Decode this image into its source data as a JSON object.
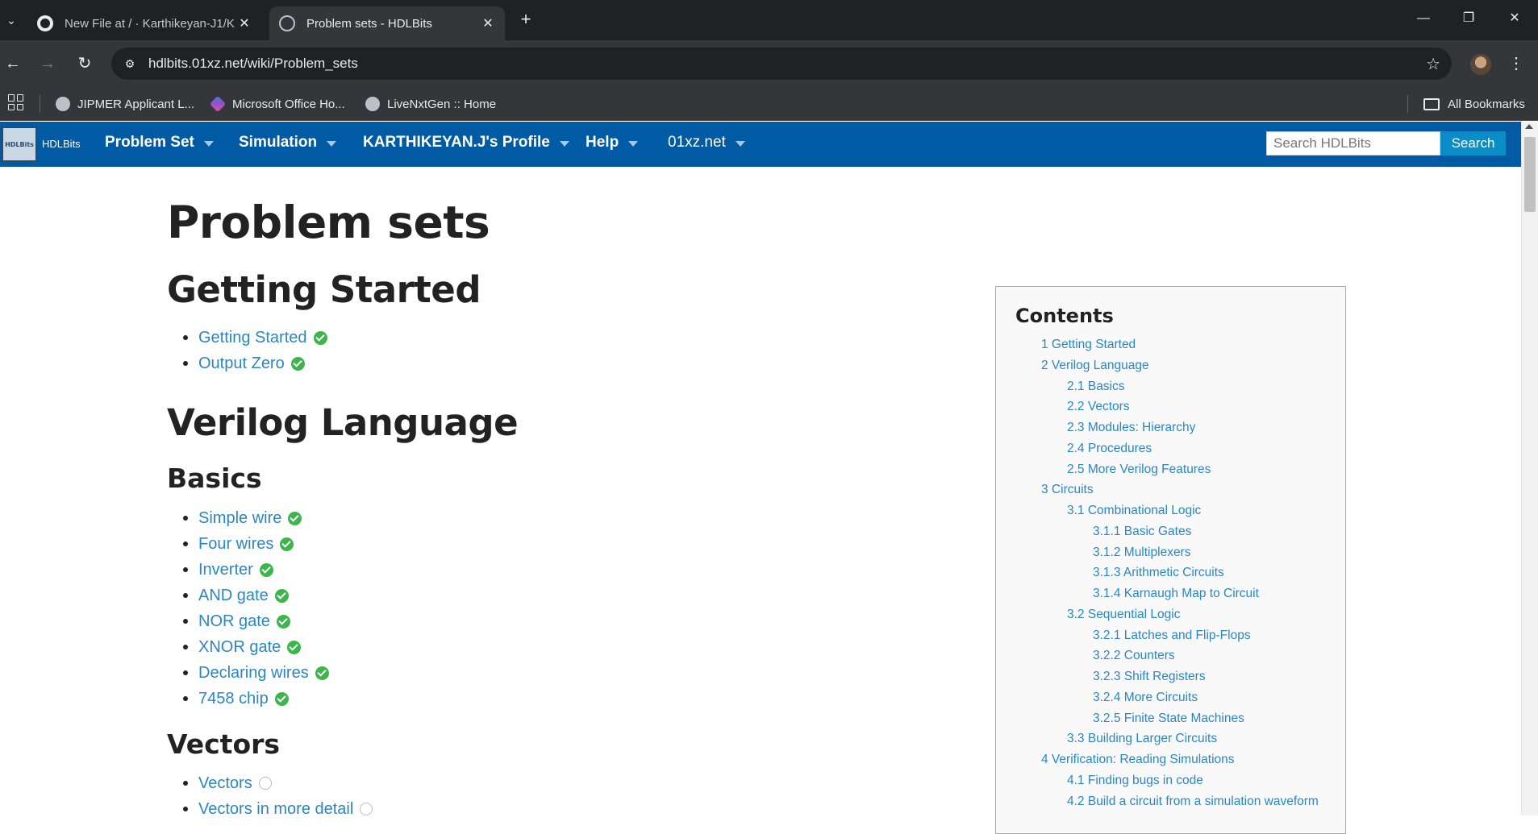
{
  "browser": {
    "tabs": [
      {
        "title": "New File at / · Karthikeyan-J1/K",
        "active": false,
        "icon": "github-icon"
      },
      {
        "title": "Problem sets - HDLBits",
        "active": true,
        "icon": "globe-icon"
      }
    ],
    "url": "hdlbits.01xz.net/wiki/Problem_sets",
    "bookmarks": [
      {
        "label": "JIPMER Applicant L...",
        "icon": "globe-icon"
      },
      {
        "label": "Microsoft Office Ho...",
        "icon": "office-icon"
      },
      {
        "label": "LiveNxtGen :: Home",
        "icon": "globe-icon"
      }
    ],
    "all_bookmarks": "All Bookmarks"
  },
  "site": {
    "logo_text": "HDLBits",
    "logo_mark": "HDLBits",
    "nav": [
      {
        "label": "Problem Set"
      },
      {
        "label": "Simulation"
      },
      {
        "label": "KARTHIKEYAN.J's Profile"
      },
      {
        "label": "Help"
      },
      {
        "label": "01xz.net"
      }
    ],
    "search_placeholder": "Search HDLBits",
    "search_button": "Search"
  },
  "page": {
    "title": "Problem sets",
    "sections": {
      "getting_started": {
        "heading": "Getting Started",
        "items": [
          {
            "label": "Getting Started",
            "status": "solved"
          },
          {
            "label": "Output Zero",
            "status": "solved"
          }
        ]
      },
      "verilog": {
        "heading": "Verilog Language",
        "basics": {
          "heading": "Basics",
          "items": [
            {
              "label": "Simple wire",
              "status": "solved"
            },
            {
              "label": "Four wires",
              "status": "solved"
            },
            {
              "label": "Inverter",
              "status": "solved"
            },
            {
              "label": "AND gate",
              "status": "solved"
            },
            {
              "label": "NOR gate",
              "status": "solved"
            },
            {
              "label": "XNOR gate",
              "status": "solved"
            },
            {
              "label": "Declaring wires",
              "status": "solved"
            },
            {
              "label": "7458 chip",
              "status": "solved"
            }
          ]
        },
        "vectors": {
          "heading": "Vectors",
          "items": [
            {
              "label": "Vectors",
              "status": "unsolved"
            },
            {
              "label": "Vectors in more detail",
              "status": "unsolved"
            }
          ]
        }
      }
    }
  },
  "toc": {
    "title": "Contents",
    "items": [
      {
        "label": "1 Getting Started",
        "level": 1
      },
      {
        "label": "2 Verilog Language",
        "level": 1
      },
      {
        "label": "2.1 Basics",
        "level": 2
      },
      {
        "label": "2.2 Vectors",
        "level": 2
      },
      {
        "label": "2.3 Modules: Hierarchy",
        "level": 2
      },
      {
        "label": "2.4 Procedures",
        "level": 2
      },
      {
        "label": "2.5 More Verilog Features",
        "level": 2
      },
      {
        "label": "3 Circuits",
        "level": 1
      },
      {
        "label": "3.1 Combinational Logic",
        "level": 2
      },
      {
        "label": "3.1.1 Basic Gates",
        "level": 3
      },
      {
        "label": "3.1.2 Multiplexers",
        "level": 3
      },
      {
        "label": "3.1.3 Arithmetic Circuits",
        "level": 3
      },
      {
        "label": "3.1.4 Karnaugh Map to Circuit",
        "level": 3
      },
      {
        "label": "3.2 Sequential Logic",
        "level": 2
      },
      {
        "label": "3.2.1 Latches and Flip-Flops",
        "level": 3
      },
      {
        "label": "3.2.2 Counters",
        "level": 3
      },
      {
        "label": "3.2.3 Shift Registers",
        "level": 3
      },
      {
        "label": "3.2.4 More Circuits",
        "level": 3
      },
      {
        "label": "3.2.5 Finite State Machines",
        "level": 3
      },
      {
        "label": "3.3 Building Larger Circuits",
        "level": 2
      },
      {
        "label": "4 Verification: Reading Simulations",
        "level": 1
      },
      {
        "label": "4.1 Finding bugs in code",
        "level": 2
      },
      {
        "label": "4.2 Build a circuit from a simulation waveform",
        "level": 2
      }
    ]
  },
  "colors": {
    "nav_bg": "#005ba4",
    "link": "#2a86c4",
    "solved": "#3cb54a",
    "search_button": "#0a8dc6"
  }
}
